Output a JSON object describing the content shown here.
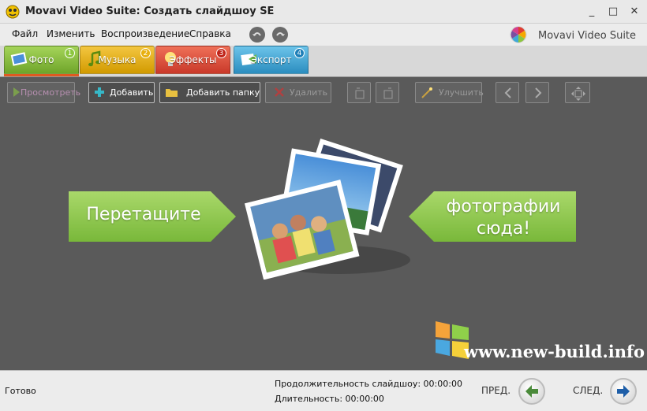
{
  "window": {
    "title": "Movavi Video Suite: Создать слайдшоу SE",
    "minimize": "_",
    "maximize": "□",
    "close": "✕"
  },
  "menu": {
    "items": [
      "Файл",
      "Изменить",
      "Воспроизведение",
      "Справка"
    ],
    "brand": "Movavi Video Suite"
  },
  "tabs": [
    {
      "label": "Фото",
      "num": "1",
      "color": "#8cc63f",
      "icon": "photo-icon"
    },
    {
      "label": "Музыка",
      "num": "2",
      "color": "#e8b010",
      "icon": "music-note-icon"
    },
    {
      "label": "Эффекты",
      "num": "3",
      "color": "#e1533b",
      "icon": "lightbulb-icon"
    },
    {
      "label": "Экспорт",
      "num": "4",
      "color": "#3fa9d8",
      "icon": "export-icon"
    }
  ],
  "toolbar": {
    "preview": "Просмотреть",
    "add": "Добавить",
    "add_folder": "Добавить папку",
    "delete": "Удалить",
    "enhance": "Улучшить"
  },
  "canvas": {
    "drag_left": "Перетащите",
    "drag_right_line1": "фотографии",
    "drag_right_line2": "сюда!"
  },
  "watermark": {
    "text": "www.new-build.info"
  },
  "status": {
    "ready": "Готово",
    "slideshow_duration": "Продолжительность слайдшоу: 00:00:00",
    "duration": "Длительность: 00:00:00",
    "prev": "ПРЕД.",
    "next": "СЛЕД."
  },
  "colors": {
    "accent_green": "#8cc63f",
    "canvas_bg": "#5a5a5a",
    "next_arrow": "#1e5ea8",
    "prev_arrow": "#4a8a3a"
  }
}
